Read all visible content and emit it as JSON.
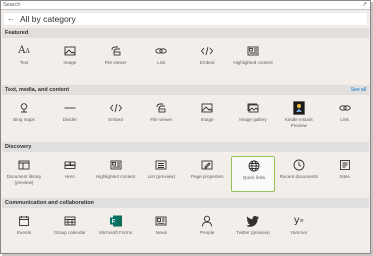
{
  "search": {
    "placeholder": "Search"
  },
  "header": {
    "title": "All by category"
  },
  "sections": [
    {
      "label": "Featured",
      "tiles": [
        {
          "label": "Text",
          "icon": "text-icon"
        },
        {
          "label": "Image",
          "icon": "image-icon"
        },
        {
          "label": "File viewer",
          "icon": "file-viewer-icon"
        },
        {
          "label": "Link",
          "icon": "link-icon"
        },
        {
          "label": "Embed",
          "icon": "embed-icon"
        },
        {
          "label": "Highlighted content",
          "icon": "highlighted-content-icon"
        }
      ]
    },
    {
      "label": "Text, media, and content",
      "see_all": "See all",
      "tiles": [
        {
          "label": "Bing maps",
          "icon": "map-pin-icon"
        },
        {
          "label": "Divider",
          "icon": "divider-icon"
        },
        {
          "label": "Embed",
          "icon": "embed-icon"
        },
        {
          "label": "File viewer",
          "icon": "file-viewer-icon"
        },
        {
          "label": "Image",
          "icon": "image-icon"
        },
        {
          "label": "Image gallery",
          "icon": "image-gallery-icon"
        },
        {
          "label": "Kindle Instant Preview",
          "icon": "kindle-icon"
        },
        {
          "label": "Link",
          "icon": "link-icon"
        }
      ]
    },
    {
      "label": "Discovery",
      "tiles": [
        {
          "label": "Document library (preview)",
          "icon": "document-library-icon"
        },
        {
          "label": "Hero",
          "icon": "hero-icon"
        },
        {
          "label": "Highlighted content",
          "icon": "highlighted-content-icon"
        },
        {
          "label": "List (preview)",
          "icon": "list-icon"
        },
        {
          "label": "Page properties",
          "icon": "page-properties-icon"
        },
        {
          "label": "Quick links",
          "icon": "globe-icon",
          "selected": true
        },
        {
          "label": "Recent documents",
          "icon": "clock-icon"
        },
        {
          "label": "Sites",
          "icon": "sites-icon"
        }
      ]
    },
    {
      "label": "Communication and collaboration",
      "tiles": [
        {
          "label": "Events",
          "icon": "events-icon"
        },
        {
          "label": "Group calendar",
          "icon": "calendar-icon"
        },
        {
          "label": "Microsoft Forms",
          "icon": "forms-icon"
        },
        {
          "label": "News",
          "icon": "news-icon"
        },
        {
          "label": "People",
          "icon": "person-icon"
        },
        {
          "label": "Twitter (preview)",
          "icon": "twitter-icon"
        },
        {
          "label": "Yammer",
          "icon": "yammer-icon"
        }
      ]
    }
  ],
  "colors": {
    "accent": "#0078d4",
    "selected_border": "#92c353",
    "section_bg": "#e1dfdd",
    "panel_bg": "#f3eeea"
  }
}
